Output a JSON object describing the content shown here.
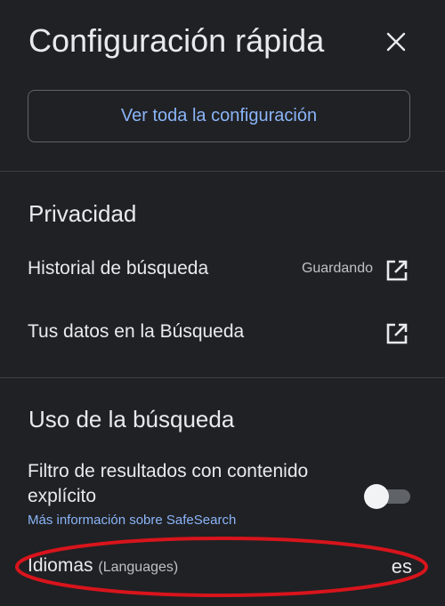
{
  "header": {
    "title": "Configuración rápida",
    "close_icon": "close-icon"
  },
  "config_button": {
    "label": "Ver toda la configuración"
  },
  "privacy": {
    "title": "Privacidad",
    "items": [
      {
        "label": "Historial de búsqueda",
        "status": "Guardando",
        "icon": "external-link-icon"
      },
      {
        "label": "Tus datos en la Búsqueda",
        "status": "",
        "icon": "external-link-icon"
      }
    ]
  },
  "search_usage": {
    "title": "Uso de la búsqueda",
    "safesearch": {
      "label": "Filtro de resultados con contenido explícito",
      "link": "Más información sobre SafeSearch",
      "enabled": false
    },
    "languages": {
      "label": "Idiomas",
      "sublabel": "(Languages)",
      "value": "es"
    }
  },
  "colors": {
    "background": "#202124",
    "text": "#e8eaed",
    "link": "#8ab4f8",
    "divider": "#3c4043",
    "annotation": "#d8141c"
  }
}
